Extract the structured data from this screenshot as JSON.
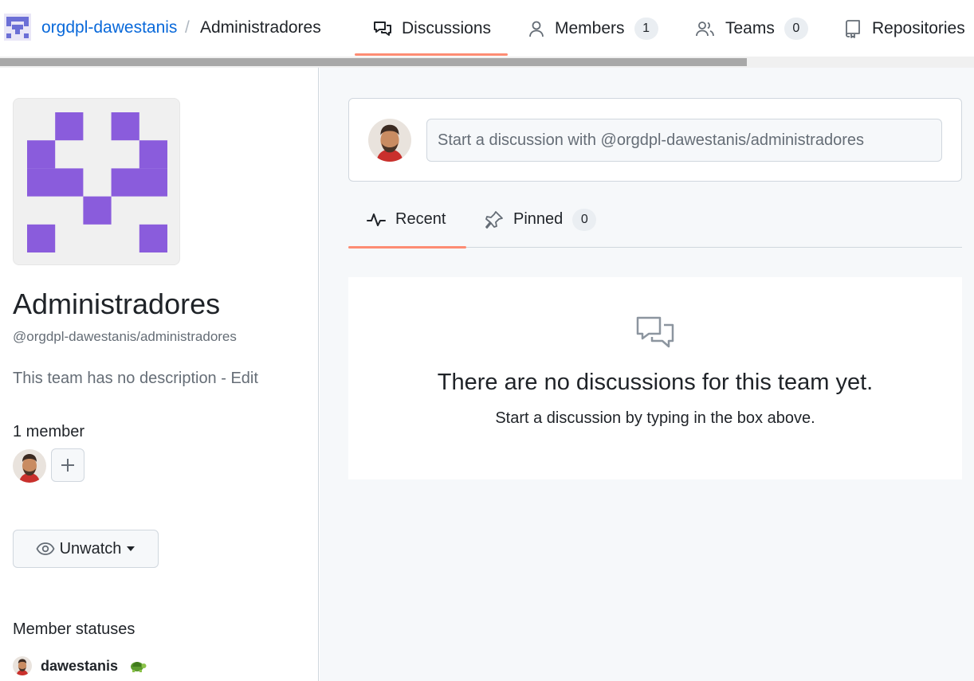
{
  "header": {
    "org_name": "orgdpl-dawestanis",
    "separator": "/",
    "team_name": "Administradores",
    "tabs": [
      {
        "label": "Discussions",
        "icon": "comment-discussion-icon",
        "selected": true
      },
      {
        "label": "Members",
        "icon": "person-icon",
        "count": "1"
      },
      {
        "label": "Teams",
        "icon": "people-icon",
        "count": "0"
      },
      {
        "label": "Repositories",
        "icon": "repo-icon"
      }
    ]
  },
  "sidebar": {
    "title": "Administradores",
    "handle": "@orgdpl-dawestanis/administradores",
    "description": "This team has no description",
    "description_sep": " - ",
    "edit_label": "Edit",
    "member_count": "1 member",
    "unwatch_label": "Unwatch",
    "member_statuses_heading": "Member statuses",
    "statuses": [
      {
        "username": "dawestanis",
        "emoji": "turtle-emoji"
      }
    ]
  },
  "main": {
    "compose_placeholder": "Start a discussion with @orgdpl-dawestanis/administradores",
    "subtabs": [
      {
        "label": "Recent",
        "icon": "pulse-icon",
        "selected": true
      },
      {
        "label": "Pinned",
        "icon": "pin-icon",
        "count": "0"
      }
    ],
    "blankslate_title": "There are no discussions for this team yet.",
    "blankslate_subtitle": "Start a discussion by typing in the box above."
  },
  "colors": {
    "accent_underline": "#fd8c73",
    "link": "#0969da",
    "identicon": "#8a5cdc"
  }
}
